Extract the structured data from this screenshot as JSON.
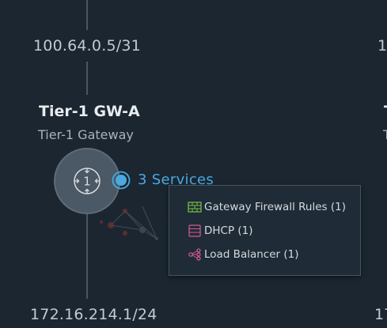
{
  "topology": {
    "uplink_ip": "100.64.0.5/31",
    "downlink_ip": "172.16.214.1/24",
    "gateway": {
      "name": "Tier-1 GW-A",
      "type": "Tier-1 Gateway"
    },
    "services_label": "3 Services",
    "right_partial": {
      "uplink_ip": "10",
      "name": "T",
      "type": "T",
      "downlink_ip": "17"
    }
  },
  "services_popup": {
    "items": [
      {
        "label": "Gateway Firewall Rules (1)",
        "icon": "firewall-icon",
        "color": "#7dc242"
      },
      {
        "label": "DHCP (1)",
        "icon": "dhcp-server-icon",
        "color": "#d45a9a"
      },
      {
        "label": "Load Balancer (1)",
        "icon": "load-balancer-icon",
        "color": "#d45a9a"
      }
    ]
  },
  "colors": {
    "background": "#1b2631",
    "accent": "#4aa9df",
    "node": "#4b5866"
  }
}
